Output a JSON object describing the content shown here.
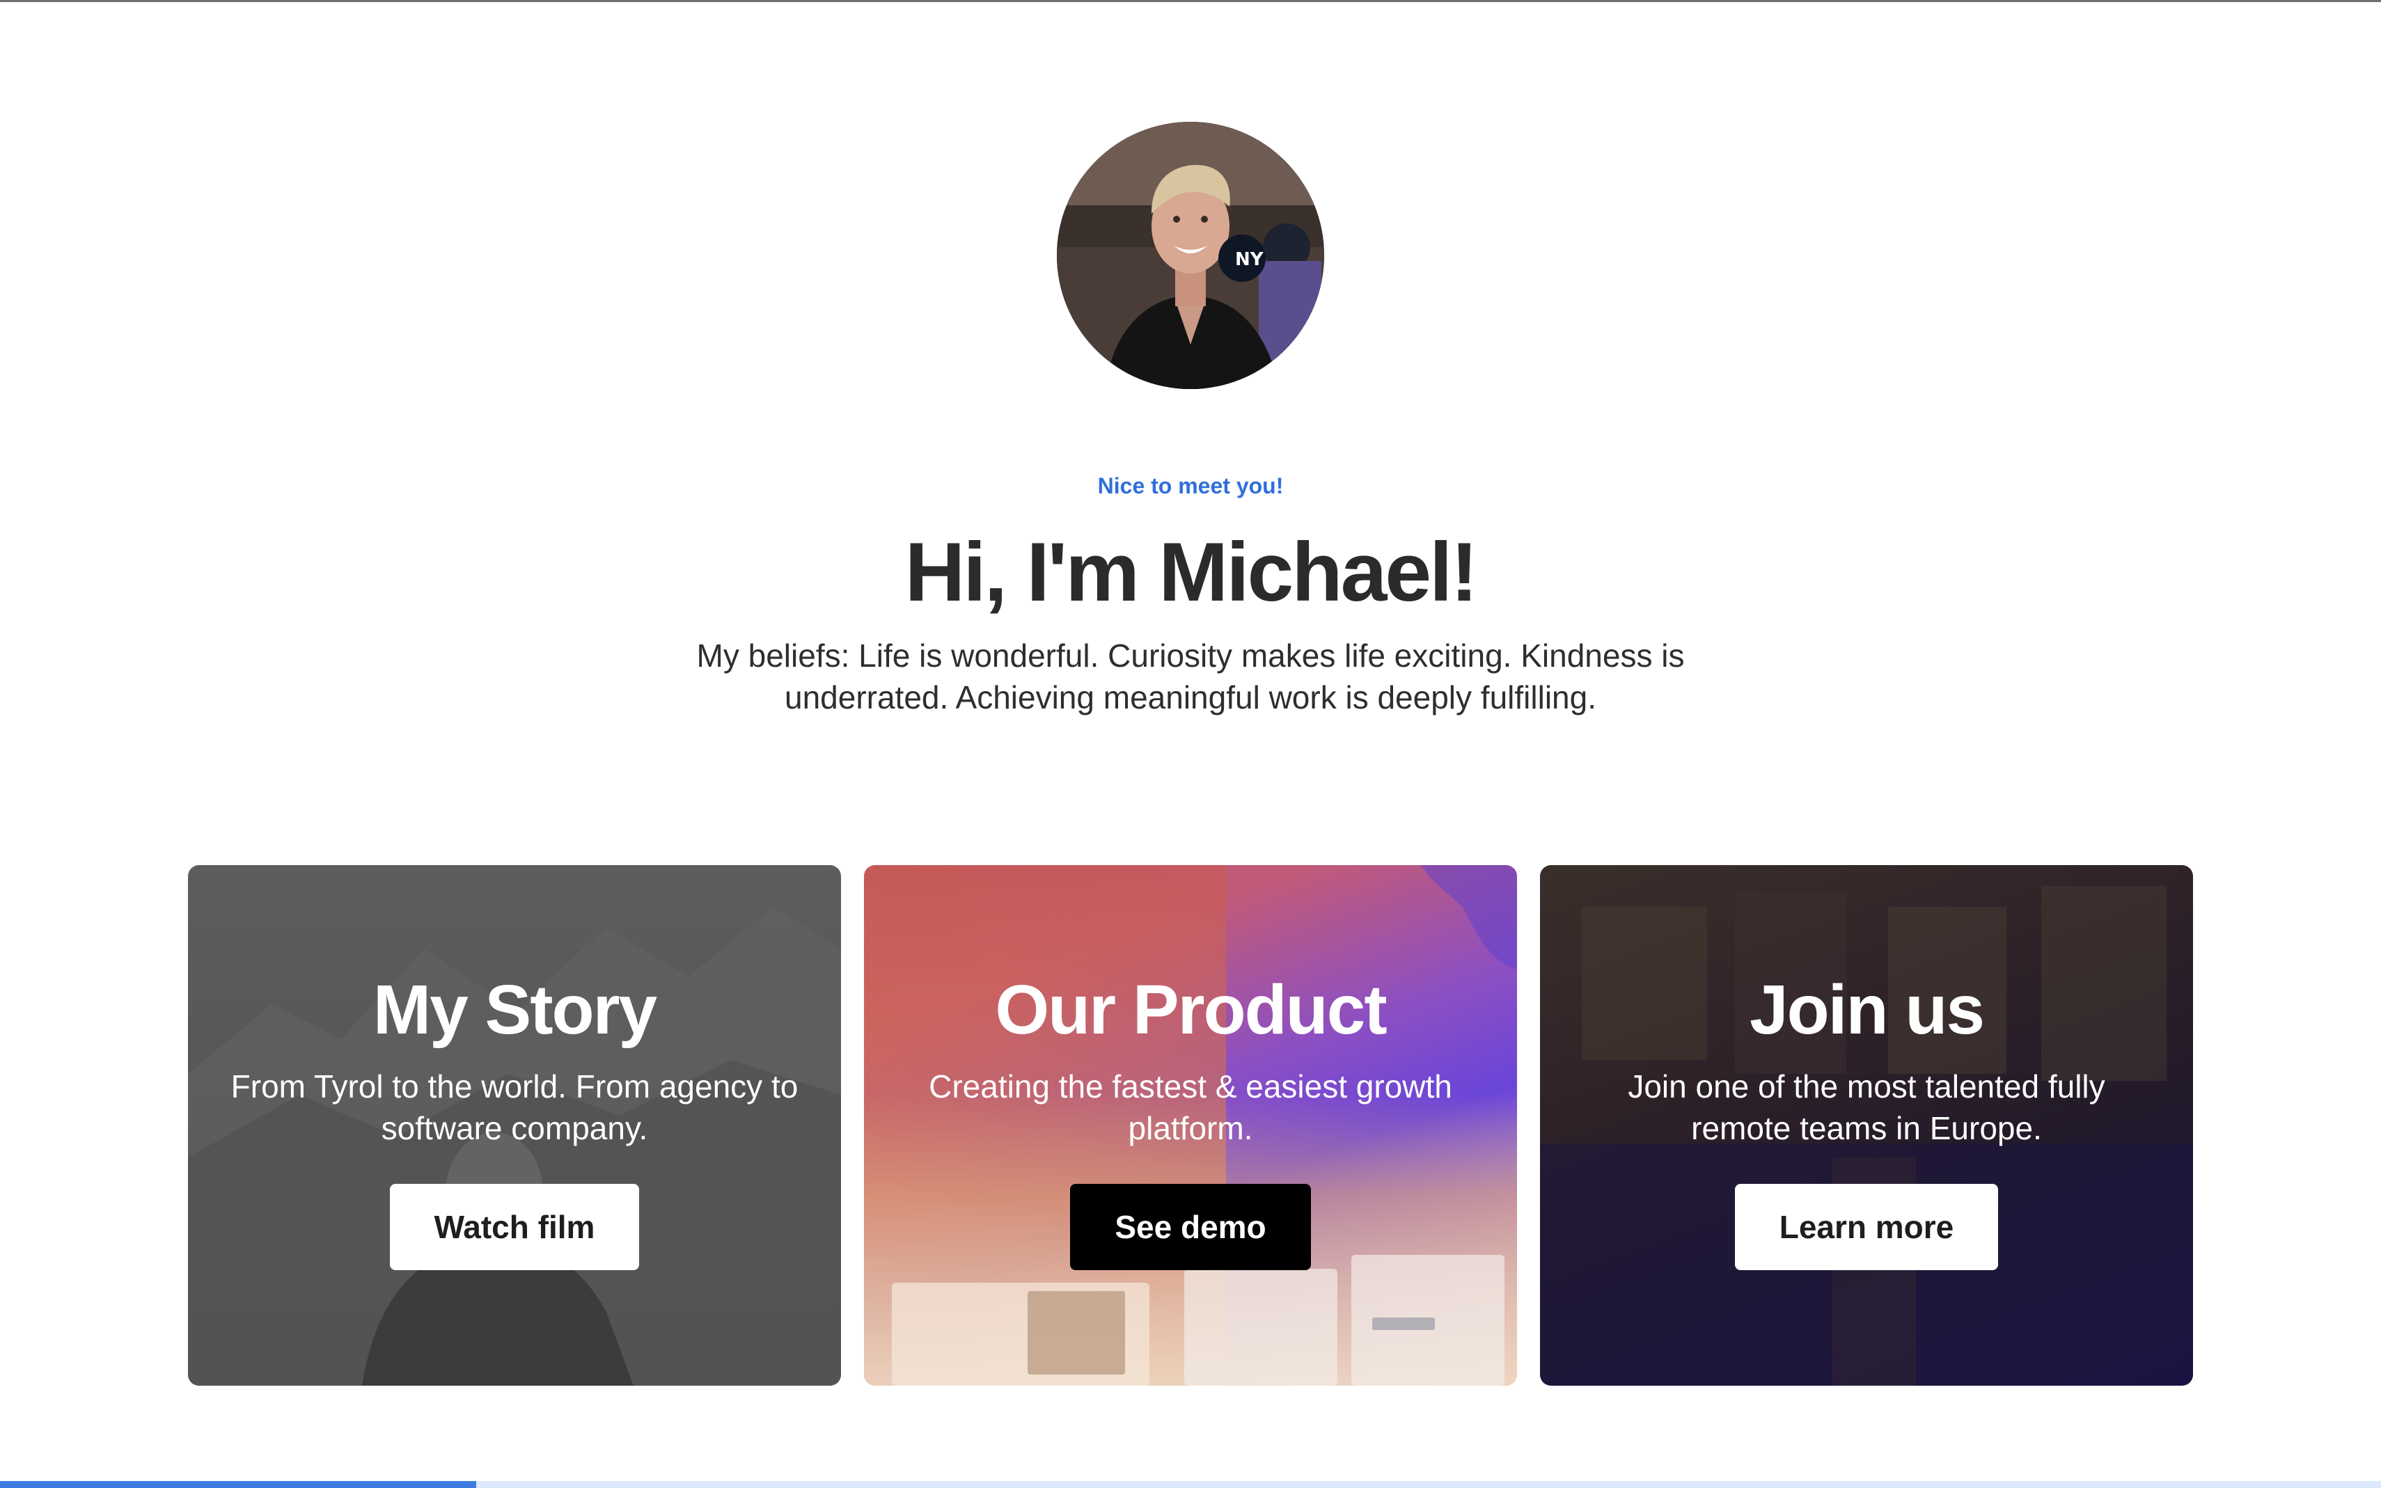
{
  "hero": {
    "eyebrow": "Nice to meet you!",
    "title": "Hi, I'm Michael!",
    "subtitle": "My beliefs: Life is wonderful. Curiosity makes life exciting. Kindness is underrated. Achieving meaningful work is deeply fulfilling."
  },
  "cards": [
    {
      "title": "My Story",
      "text": "From Tyrol to the world. From agency to software company.",
      "button": "Watch film"
    },
    {
      "title": "Our Product",
      "text": "Creating the fastest & easiest growth platform.",
      "button": "See demo"
    },
    {
      "title": "Join us",
      "text": "Join one of the most talented fully remote teams in Europe.",
      "button": "Learn more"
    }
  ],
  "scroll_progress": 0.2,
  "colors": {
    "accent": "#2f6fdb",
    "progress": "#3f7ae0",
    "heading": "#2b2b2b"
  }
}
